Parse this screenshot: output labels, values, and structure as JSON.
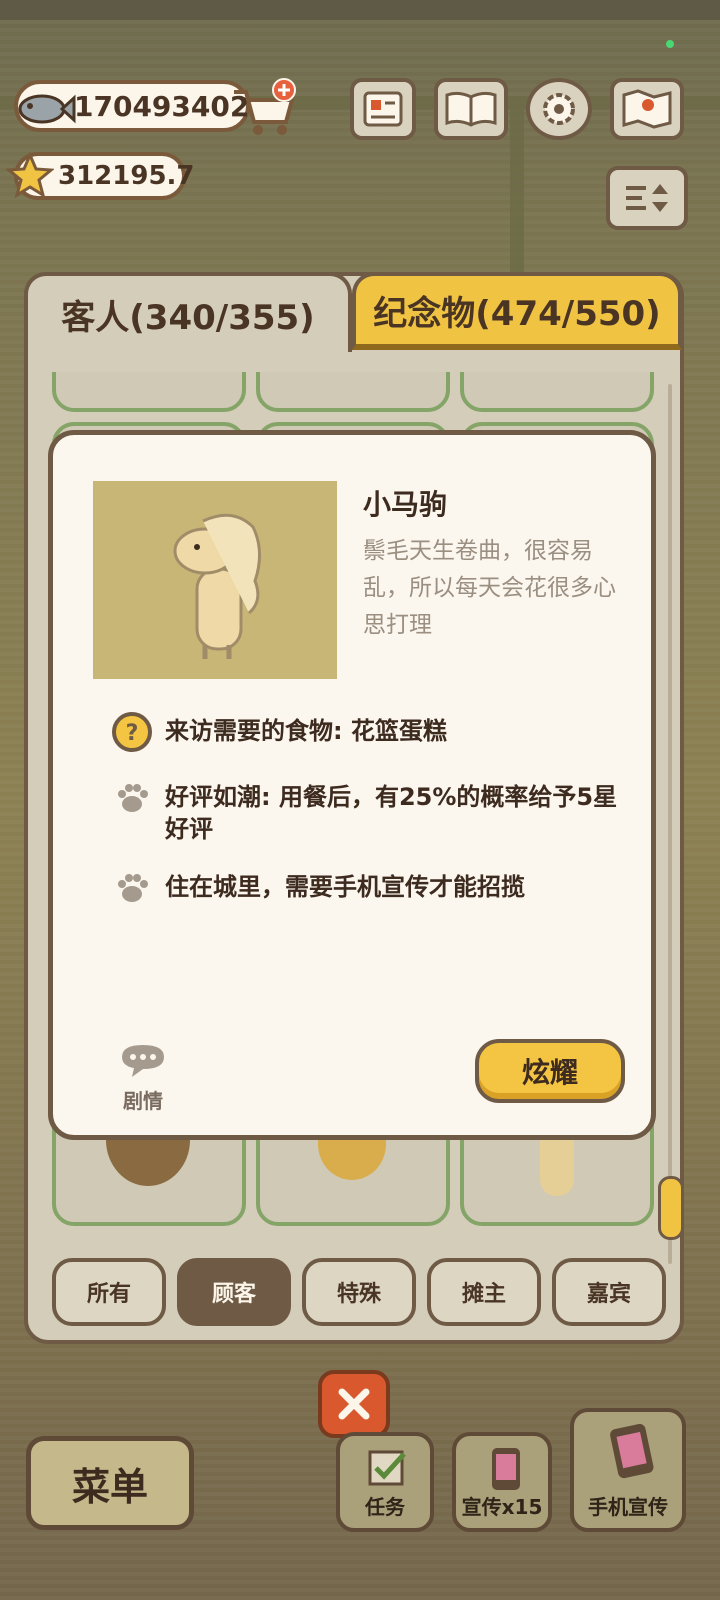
{
  "currency": {
    "fish": "170493402",
    "stars": "312195.7"
  },
  "tabs": [
    {
      "label": "客人(340/355)"
    },
    {
      "label": "纪念物(474/550)"
    }
  ],
  "filters": [
    "所有",
    "顾客",
    "特殊",
    "摊主",
    "嘉宾"
  ],
  "active_filter": "顾客",
  "detail": {
    "name": "小马驹",
    "description": "鬃毛天生卷曲，很容易乱，所以每天会花很多心思打理",
    "rows": [
      "来访需要的食物: 花篮蛋糕",
      "好评如潮: 用餐后，有25%的概率给予5星好评",
      "住在城里，需要手机宣传才能招揽"
    ],
    "story_label": "剧情",
    "show_button": "炫耀"
  },
  "bottom": {
    "menu": "菜单",
    "tasks": "任务",
    "promo_x15": "宣传x15",
    "phone_promo": "手机宣传"
  },
  "colors": {
    "accent_yellow": "#f4c542",
    "border_brown": "#6f5a45",
    "close_red": "#d9582e"
  }
}
